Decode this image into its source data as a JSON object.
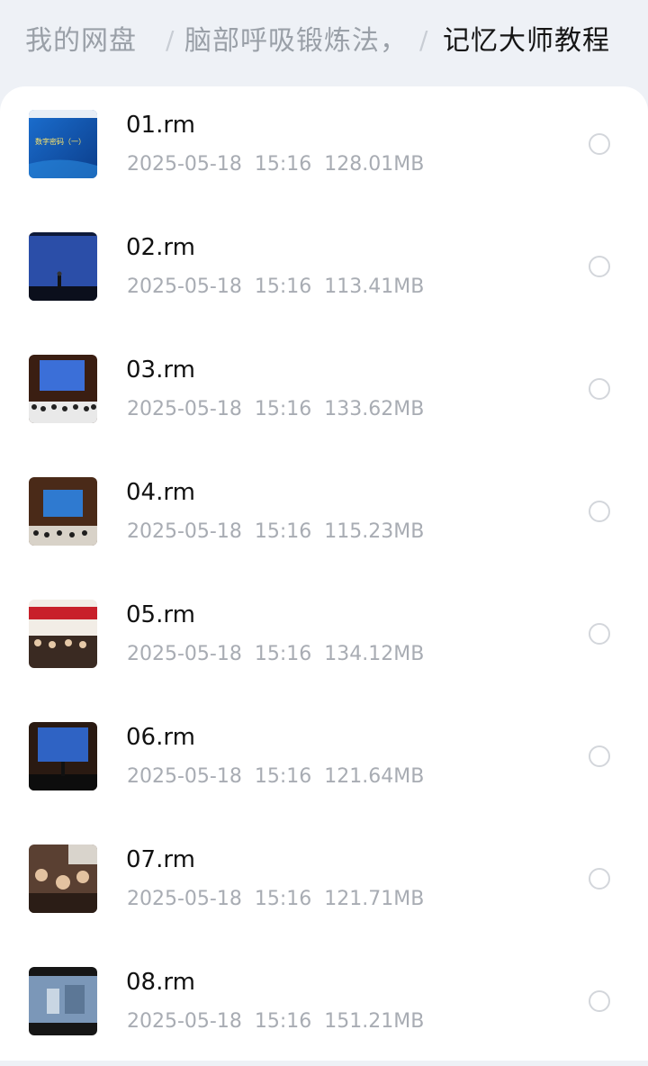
{
  "breadcrumb": {
    "root": "我的网盘",
    "middle": "脑部呼吸锻炼法，",
    "current": "记忆大师教程",
    "separator": "/"
  },
  "files": [
    {
      "name": "01.rm",
      "date": "2025-05-18",
      "time": "15:16",
      "size": "128.01MB"
    },
    {
      "name": "02.rm",
      "date": "2025-05-18",
      "time": "15:16",
      "size": "113.41MB"
    },
    {
      "name": "03.rm",
      "date": "2025-05-18",
      "time": "15:16",
      "size": "133.62MB"
    },
    {
      "name": "04.rm",
      "date": "2025-05-18",
      "time": "15:16",
      "size": "115.23MB"
    },
    {
      "name": "05.rm",
      "date": "2025-05-18",
      "time": "15:16",
      "size": "134.12MB"
    },
    {
      "name": "06.rm",
      "date": "2025-05-18",
      "time": "15:16",
      "size": "121.64MB"
    },
    {
      "name": "07.rm",
      "date": "2025-05-18",
      "time": "15:16",
      "size": "121.71MB"
    },
    {
      "name": "08.rm",
      "date": "2025-05-18",
      "time": "15:16",
      "size": "151.21MB"
    }
  ],
  "thumb_text": {
    "slide_title": "数字密码（一）"
  }
}
